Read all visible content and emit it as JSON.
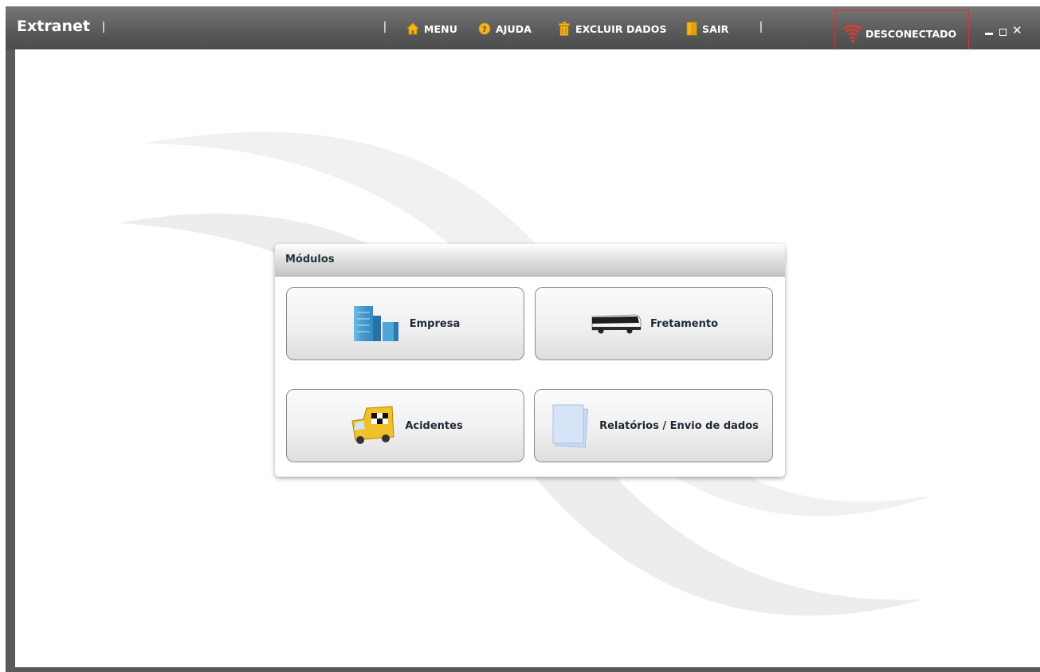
{
  "app": {
    "title": "Extranet",
    "separator": "|"
  },
  "nav": [
    {
      "label": "MENU",
      "icon": "home-icon"
    },
    {
      "label": "AJUDA",
      "icon": "help-icon"
    },
    {
      "label": "EXCLUIR DADOS",
      "icon": "trash-icon"
    },
    {
      "label": "SAIR",
      "icon": "exit-door-icon"
    }
  ],
  "status": {
    "label": "DESCONECTADO",
    "icon": "signal-icon",
    "color": "#d9342b"
  },
  "window_controls": {
    "close": "✕"
  },
  "modules": {
    "title": "Módulos",
    "items": [
      {
        "label": "Empresa",
        "icon": "building-icon"
      },
      {
        "label": "Fretamento",
        "icon": "bus-icon"
      },
      {
        "label": "Acidentes",
        "icon": "accident-truck-icon"
      },
      {
        "label": "Relatórios / Envio de dados",
        "icon": "documents-icon"
      }
    ]
  },
  "colors": {
    "titlebar": "#5a5a5a",
    "accent_highlight": "#d9342b",
    "panel_text": "#26303a"
  }
}
